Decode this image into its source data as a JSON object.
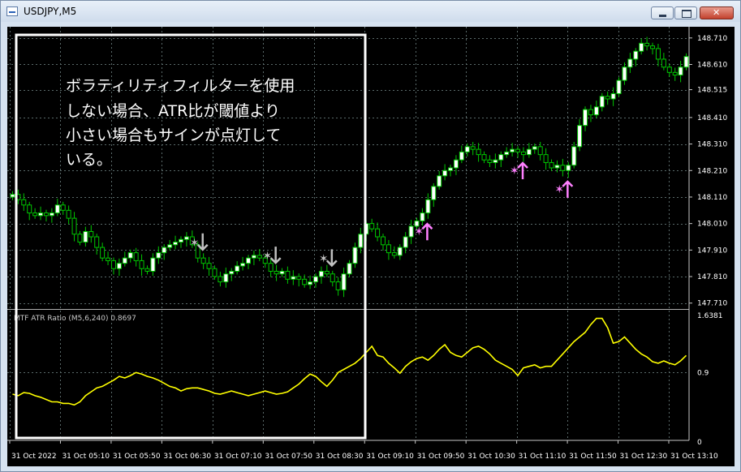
{
  "window": {
    "title": "USDJPY,M5"
  },
  "colors": {
    "bull": "#ffffff",
    "bear": "#00c800",
    "wick": "#00c800",
    "indicator": "#ffff00",
    "sell_arrow": "#c0c0c0",
    "buy_arrow": "#ff80ff",
    "grid": "#5a6a6a",
    "annotation_box": "#ffffff"
  },
  "annotation": {
    "lines": [
      "ボラティリティフィルターを使用",
      "しない場合、ATR比が閾値より",
      "小さい場合もサインが点灯して",
      "いる。"
    ]
  },
  "chart_data": [
    {
      "type": "candlestick",
      "symbol": "USDJPY",
      "timeframe": "M5",
      "ylim": [
        147.7,
        148.74
      ],
      "y_ticks": [
        "148.710",
        "148.610",
        "148.515",
        "148.410",
        "148.310",
        "148.210",
        "148.110",
        "148.010",
        "147.910",
        "147.810",
        "147.710"
      ],
      "x_ticks": [
        "31 Oct 2022",
        "31 Oct 05:10",
        "31 Oct 05:50",
        "31 Oct 06:30",
        "31 Oct 07:10",
        "31 Oct 07:50",
        "31 Oct 08:30",
        "31 Oct 09:10",
        "31 Oct 09:50",
        "31 Oct 10:30",
        "31 Oct 11:10",
        "31 Oct 11:50",
        "31 Oct 12:30",
        "31 Oct 13:10"
      ],
      "close": [
        148.12,
        148.1,
        148.08,
        148.05,
        148.04,
        148.05,
        148.04,
        148.05,
        148.08,
        148.06,
        148.03,
        147.97,
        147.94,
        147.98,
        147.96,
        147.92,
        147.88,
        147.87,
        147.84,
        147.86,
        147.88,
        147.9,
        147.87,
        147.84,
        147.83,
        147.88,
        147.9,
        147.92,
        147.93,
        147.94,
        147.95,
        147.96,
        147.93,
        147.88,
        147.86,
        147.84,
        147.81,
        147.79,
        147.82,
        147.83,
        147.85,
        147.86,
        147.88,
        147.89,
        147.88,
        147.86,
        147.83,
        147.82,
        147.83,
        147.8,
        147.81,
        147.8,
        147.78,
        147.79,
        147.81,
        147.83,
        147.82,
        147.79,
        147.76,
        147.82,
        147.86,
        147.92,
        147.97,
        148.01,
        147.99,
        147.96,
        147.93,
        147.9,
        147.89,
        147.92,
        147.96,
        148.0,
        148.02,
        148.05,
        148.1,
        148.15,
        148.19,
        148.21,
        148.22,
        148.25,
        148.28,
        148.3,
        148.29,
        148.27,
        148.25,
        148.24,
        148.25,
        148.27,
        148.28,
        148.29,
        148.28,
        148.27,
        148.29,
        148.3,
        148.27,
        148.24,
        148.22,
        148.23,
        148.21,
        148.23,
        148.3,
        148.38,
        148.44,
        148.42,
        148.45,
        148.49,
        148.48,
        148.5,
        148.55,
        148.6,
        148.63,
        148.66,
        148.69,
        148.68,
        148.67,
        148.63,
        148.6,
        148.58,
        148.57,
        148.6,
        148.64
      ],
      "signals": [
        {
          "type": "sell",
          "bar": 33
        },
        {
          "type": "sell",
          "bar": 46
        },
        {
          "type": "sell",
          "bar": 56
        },
        {
          "type": "buy",
          "bar": 73
        },
        {
          "type": "buy",
          "bar": 90
        },
        {
          "type": "buy",
          "bar": 98
        }
      ]
    },
    {
      "type": "line",
      "title": "MTF ATR Ratio (M5,6,240) 0.8697",
      "ylim": [
        0,
        1.6381
      ],
      "y_ticks": [
        "1.6381",
        "0.9",
        "0"
      ],
      "threshold": 0.9,
      "values": [
        0.62,
        0.6,
        0.64,
        0.63,
        0.6,
        0.58,
        0.55,
        0.52,
        0.52,
        0.5,
        0.5,
        0.48,
        0.52,
        0.6,
        0.65,
        0.7,
        0.72,
        0.76,
        0.8,
        0.85,
        0.83,
        0.86,
        0.9,
        0.88,
        0.85,
        0.83,
        0.8,
        0.76,
        0.72,
        0.7,
        0.66,
        0.69,
        0.7,
        0.7,
        0.68,
        0.66,
        0.63,
        0.62,
        0.64,
        0.66,
        0.64,
        0.62,
        0.6,
        0.62,
        0.64,
        0.66,
        0.64,
        0.62,
        0.63,
        0.65,
        0.7,
        0.75,
        0.82,
        0.88,
        0.85,
        0.78,
        0.72,
        0.8,
        0.9,
        0.94,
        0.98,
        1.02,
        1.08,
        1.16,
        1.24,
        1.12,
        1.1,
        1.02,
        0.96,
        0.89,
        0.98,
        1.04,
        1.08,
        1.1,
        1.06,
        1.12,
        1.2,
        1.26,
        1.16,
        1.12,
        1.1,
        1.16,
        1.22,
        1.24,
        1.2,
        1.14,
        1.06,
        1.02,
        0.98,
        0.94,
        0.86,
        0.96,
        0.98,
        1.0,
        0.96,
        0.98,
        0.98,
        1.06,
        1.14,
        1.22,
        1.3,
        1.36,
        1.42,
        1.52,
        1.6,
        1.6,
        1.48,
        1.28,
        1.3,
        1.36,
        1.28,
        1.2,
        1.14,
        1.1,
        1.04,
        1.02,
        1.05,
        1.02,
        1.0,
        1.05,
        1.12
      ]
    }
  ]
}
